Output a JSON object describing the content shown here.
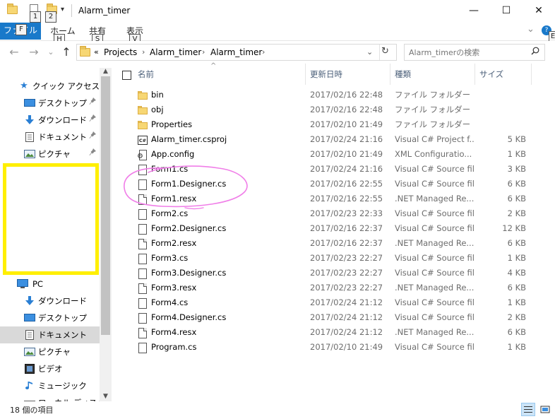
{
  "window": {
    "title": "Alarm_timer",
    "minimize_glyph": "—",
    "maximize_glyph": "☐",
    "close_glyph": "✕"
  },
  "quick_access_toolbar": {
    "keytips": [
      "1",
      "2"
    ],
    "customize_glyph": "▾"
  },
  "ribbon": {
    "file_tab": "ファイル",
    "file_keytip": "F",
    "tabs": [
      {
        "label": "ホーム",
        "keytip": "H"
      },
      {
        "label": "共有",
        "keytip": "S"
      },
      {
        "label": "表示",
        "keytip": "V"
      }
    ],
    "expand_glyph": "⌄",
    "help_keytip": "E"
  },
  "address": {
    "overflow": "«",
    "crumbs": [
      "Projects",
      "Alarm_timer",
      "Alarm_timer"
    ],
    "separator": "›",
    "dropdown_glyph": "⌄",
    "refresh_glyph": "↻",
    "back_glyph": "←",
    "forward_glyph": "→",
    "recent_glyph": "⌄",
    "up_glyph": "↑"
  },
  "search": {
    "placeholder": "Alarm_timerの検索"
  },
  "nav": {
    "quick_access": {
      "label": "クイック アクセス"
    },
    "pinned": [
      {
        "label": "デスクトップ",
        "icon": "desktop-icon"
      },
      {
        "label": "ダウンロード",
        "icon": "download-icon"
      },
      {
        "label": "ドキュメント",
        "icon": "document-icon"
      },
      {
        "label": "ピクチャ",
        "icon": "picture-icon"
      }
    ],
    "pc": {
      "label": "PC"
    },
    "pc_items": [
      {
        "label": "ダウンロード",
        "icon": "download-icon"
      },
      {
        "label": "デスクトップ",
        "icon": "desktop-icon"
      },
      {
        "label": "ドキュメント",
        "icon": "document-icon"
      },
      {
        "label": "ピクチャ",
        "icon": "picture-icon"
      },
      {
        "label": "ビデオ",
        "icon": "video-icon"
      },
      {
        "label": "ミュージック",
        "icon": "music-icon"
      },
      {
        "label": "ローカル ディスク (C",
        "icon": "drive-icon"
      }
    ]
  },
  "columns": {
    "name": "名前",
    "modified": "更新日時",
    "type": "種類",
    "size": "サイズ"
  },
  "files": [
    {
      "name": "bin",
      "date": "2017/02/16 22:48",
      "type": "ファイル フォルダー",
      "size": "",
      "icon": "folder"
    },
    {
      "name": "obj",
      "date": "2017/02/16 22:48",
      "type": "ファイル フォルダー",
      "size": "",
      "icon": "folder"
    },
    {
      "name": "Properties",
      "date": "2017/02/10 21:49",
      "type": "ファイル フォルダー",
      "size": "",
      "icon": "folder"
    },
    {
      "name": "Alarm_timer.csproj",
      "date": "2017/02/24 21:16",
      "type": "Visual C# Project f...",
      "size": "5 KB",
      "icon": "csproj"
    },
    {
      "name": "App.config",
      "date": "2017/02/10 21:49",
      "type": "XML Configuratio...",
      "size": "1 KB",
      "icon": "config"
    },
    {
      "name": "Form1.cs",
      "date": "2017/02/24 21:16",
      "type": "Visual C# Source file",
      "size": "3 KB",
      "icon": "cs"
    },
    {
      "name": "Form1.Designer.cs",
      "date": "2017/02/16 22:55",
      "type": "Visual C# Source file",
      "size": "6 KB",
      "icon": "cs"
    },
    {
      "name": "Form1.resx",
      "date": "2017/02/16 22:55",
      "type": ".NET Managed Re...",
      "size": "6 KB",
      "icon": "doc"
    },
    {
      "name": "Form2.cs",
      "date": "2017/02/23 22:33",
      "type": "Visual C# Source file",
      "size": "2 KB",
      "icon": "cs"
    },
    {
      "name": "Form2.Designer.cs",
      "date": "2017/02/16 22:37",
      "type": "Visual C# Source file",
      "size": "12 KB",
      "icon": "cs"
    },
    {
      "name": "Form2.resx",
      "date": "2017/02/16 22:37",
      "type": ".NET Managed Re...",
      "size": "6 KB",
      "icon": "doc"
    },
    {
      "name": "Form3.cs",
      "date": "2017/02/23 22:27",
      "type": "Visual C# Source file",
      "size": "1 KB",
      "icon": "cs"
    },
    {
      "name": "Form3.Designer.cs",
      "date": "2017/02/23 22:27",
      "type": "Visual C# Source file",
      "size": "4 KB",
      "icon": "cs"
    },
    {
      "name": "Form3.resx",
      "date": "2017/02/23 22:27",
      "type": ".NET Managed Re...",
      "size": "6 KB",
      "icon": "doc"
    },
    {
      "name": "Form4.cs",
      "date": "2017/02/24 21:12",
      "type": "Visual C# Source file",
      "size": "1 KB",
      "icon": "cs"
    },
    {
      "name": "Form4.Designer.cs",
      "date": "2017/02/24 21:12",
      "type": "Visual C# Source file",
      "size": "2 KB",
      "icon": "cs"
    },
    {
      "name": "Form4.resx",
      "date": "2017/02/24 21:12",
      "type": ".NET Managed Re...",
      "size": "6 KB",
      "icon": "doc"
    },
    {
      "name": "Program.cs",
      "date": "2017/02/10 21:49",
      "type": "Visual C# Source file",
      "size": "1 KB",
      "icon": "cs"
    }
  ],
  "status": {
    "item_count": "18 個の項目"
  },
  "icon_glyphs": {
    "cs": "C#",
    "csproj": "C#",
    "gear": "⚙",
    "search": "⚲",
    "star": "★",
    "pin": "📌",
    "sort_up": "^"
  },
  "colors": {
    "accent": "#1979ca",
    "annotation_pink": "#f07ee8",
    "highlight_yellow": "#ffef00",
    "selected_nav": "#d9d9d9",
    "folder_yellow": "#f7d774"
  }
}
